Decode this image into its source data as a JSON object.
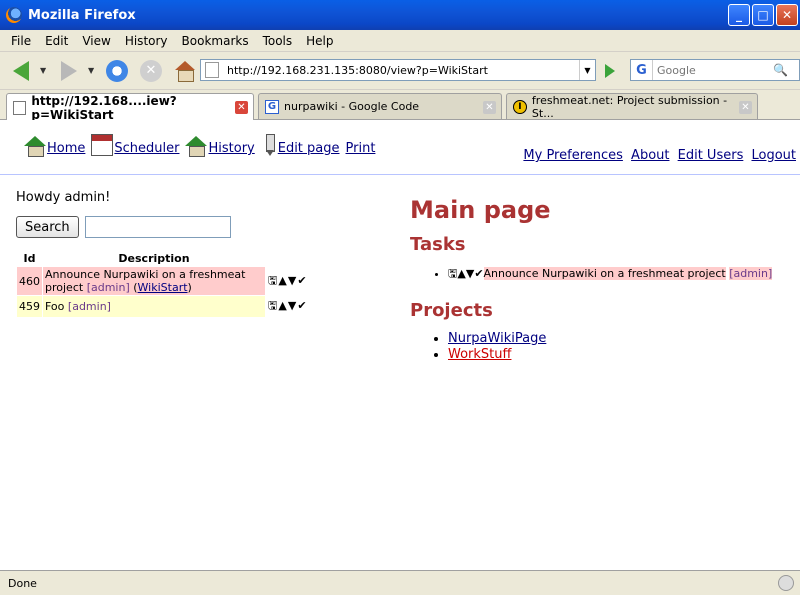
{
  "window": {
    "title": "Mozilla Firefox",
    "min_label": "_",
    "max_label": "□",
    "close_label": "✕"
  },
  "menu": {
    "items": [
      "File",
      "Edit",
      "View",
      "History",
      "Bookmarks",
      "Tools",
      "Help"
    ]
  },
  "nav": {
    "url": "http://192.168.231.135:8080/view?p=WikiStart",
    "search_placeholder": "Google",
    "search_engine_glyph": "G",
    "stop_glyph": "✕",
    "dropdown_glyph": "▼",
    "search_glyph": "🔍"
  },
  "tabs": [
    {
      "label": "http://192.168....iew?p=WikiStart",
      "active": true
    },
    {
      "label": "nurpawiki - Google Code",
      "active": false
    },
    {
      "label": "freshmeat.net: Project submission - St...",
      "active": false
    }
  ],
  "tab_icons": {
    "google": "G",
    "freshmeat": "I"
  },
  "tab_close_glyph": "✕",
  "page": {
    "topnav": {
      "home": "Home",
      "scheduler": "Scheduler",
      "history": "History",
      "edit_page": "Edit page",
      "print": "Print"
    },
    "rightnav": {
      "prefs": "My Preferences",
      "about": "About",
      "edit_users": "Edit Users",
      "logout": "Logout"
    },
    "howdy": "Howdy admin!",
    "search_button": "Search",
    "search_value": "",
    "table": {
      "headers": {
        "id": "Id",
        "description": "Description"
      },
      "rows": [
        {
          "id": "460",
          "text": "Announce Nurpawiki on a freshmeat project",
          "owner": "[admin]",
          "link_open": "(",
          "link": "WikiStart",
          "link_close": ")"
        },
        {
          "id": "459",
          "text": "Foo",
          "owner": "[admin]"
        }
      ],
      "action_glyphs": {
        "edit": "🖫",
        "up": "▲",
        "down": "▼",
        "done": "✔"
      }
    },
    "main": {
      "title": "Main page",
      "tasks_heading": "Tasks",
      "task_item": "Announce Nurpawiki on a freshmeat project",
      "task_owner": "[admin]",
      "projects_heading": "Projects",
      "projects": [
        "NurpaWikiPage",
        "WorkStuff"
      ]
    }
  },
  "status": {
    "text": "Done"
  }
}
